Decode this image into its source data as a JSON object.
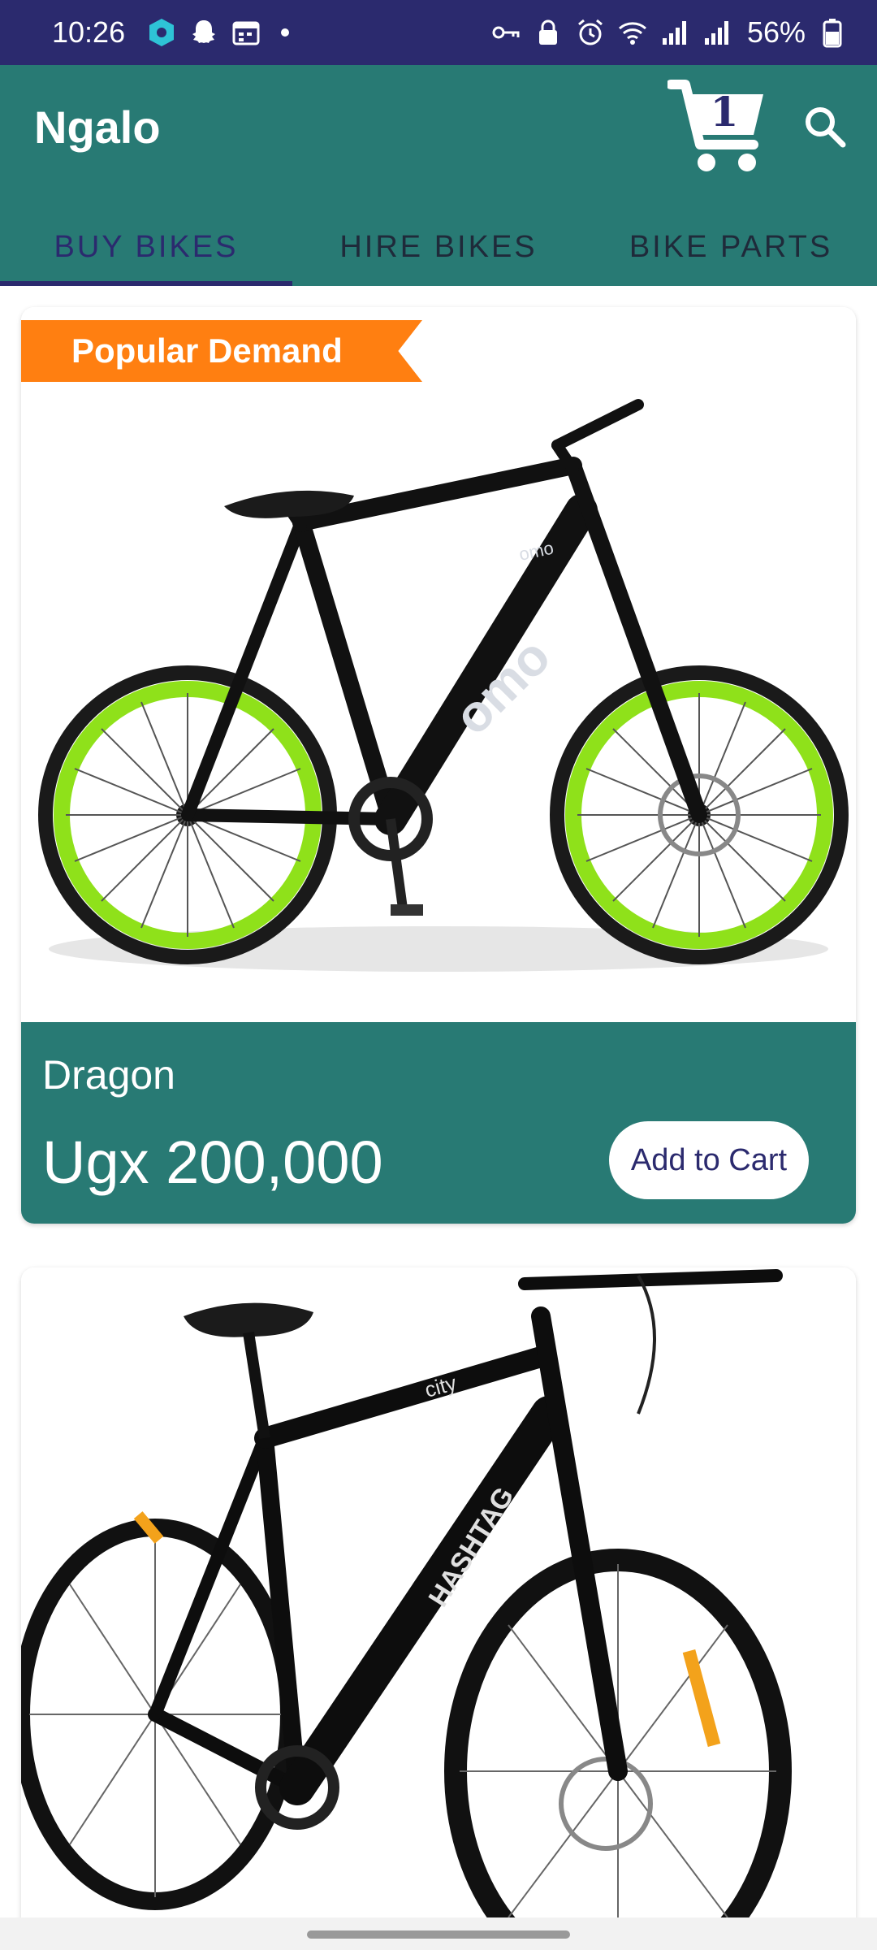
{
  "status_bar": {
    "time": "10:26",
    "battery_text": "56%",
    "left_icons": [
      "vpn-icon",
      "snapchat-icon",
      "calendar-icon"
    ],
    "right_icons": [
      "key-icon",
      "lock-icon",
      "alarm-icon",
      "wifi-icon",
      "signal-icon",
      "signal-icon",
      "battery-icon"
    ]
  },
  "app_bar": {
    "title": "Ngalo",
    "cart_count": "1",
    "cart_icon": "cart-icon",
    "search_icon": "search-icon",
    "background": "#287a74"
  },
  "tabs": [
    {
      "label": "BUY BIKES",
      "active": true
    },
    {
      "label": "HIRE BIKES",
      "active": false
    },
    {
      "label": "BIKE PARTS",
      "active": false
    }
  ],
  "products": [
    {
      "badge": "Popular Demand",
      "name": "Dragon",
      "price": "Ugx 200,000",
      "button_label": "Add to Cart",
      "image": "green-rim-bike-image"
    },
    {
      "image": "black-bike-image"
    }
  ],
  "colors": {
    "primary": "#287a74",
    "status_bar": "#2b2a6e",
    "accent": "#2b2a6e",
    "badge": "#ff7f11",
    "rim_green": "#8fe11a"
  }
}
